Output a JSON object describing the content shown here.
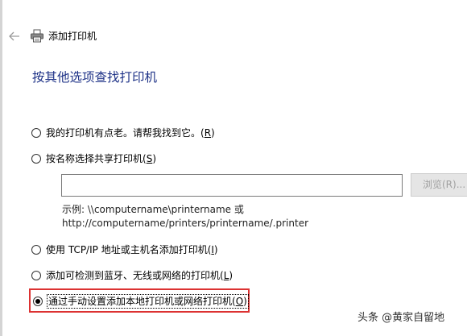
{
  "header": {
    "title": "添加打印机"
  },
  "page": {
    "heading": "按其他选项查找打印机"
  },
  "options": [
    {
      "text": "我的打印机有点老。请帮我找到它。(",
      "key": "R",
      "suffix": ")",
      "selected": false
    },
    {
      "text": "按名称选择共享打印机(",
      "key": "S",
      "suffix": ")",
      "selected": false
    },
    {
      "text": "使用 TCP/IP 地址或主机名添加打印机(",
      "key": "I",
      "suffix": ")",
      "selected": false
    },
    {
      "text": "添加可检测到蓝牙、无线或网络的打印机(",
      "key": "L",
      "suffix": ")",
      "selected": false
    },
    {
      "text": "通过手动设置添加本地打印机或网络打印机(",
      "key": "O",
      "suffix": ")",
      "selected": true
    }
  ],
  "share": {
    "input_value": "",
    "browse_label": "浏览(R)...",
    "example_line1": "示例: \\\\computername\\printername 或",
    "example_line2": "http://computername/printers/printername/.printer"
  },
  "watermark": {
    "text": "头条 @黄家自留地"
  },
  "colors": {
    "heading": "#1e3287",
    "highlight_border": "#dc3232"
  }
}
